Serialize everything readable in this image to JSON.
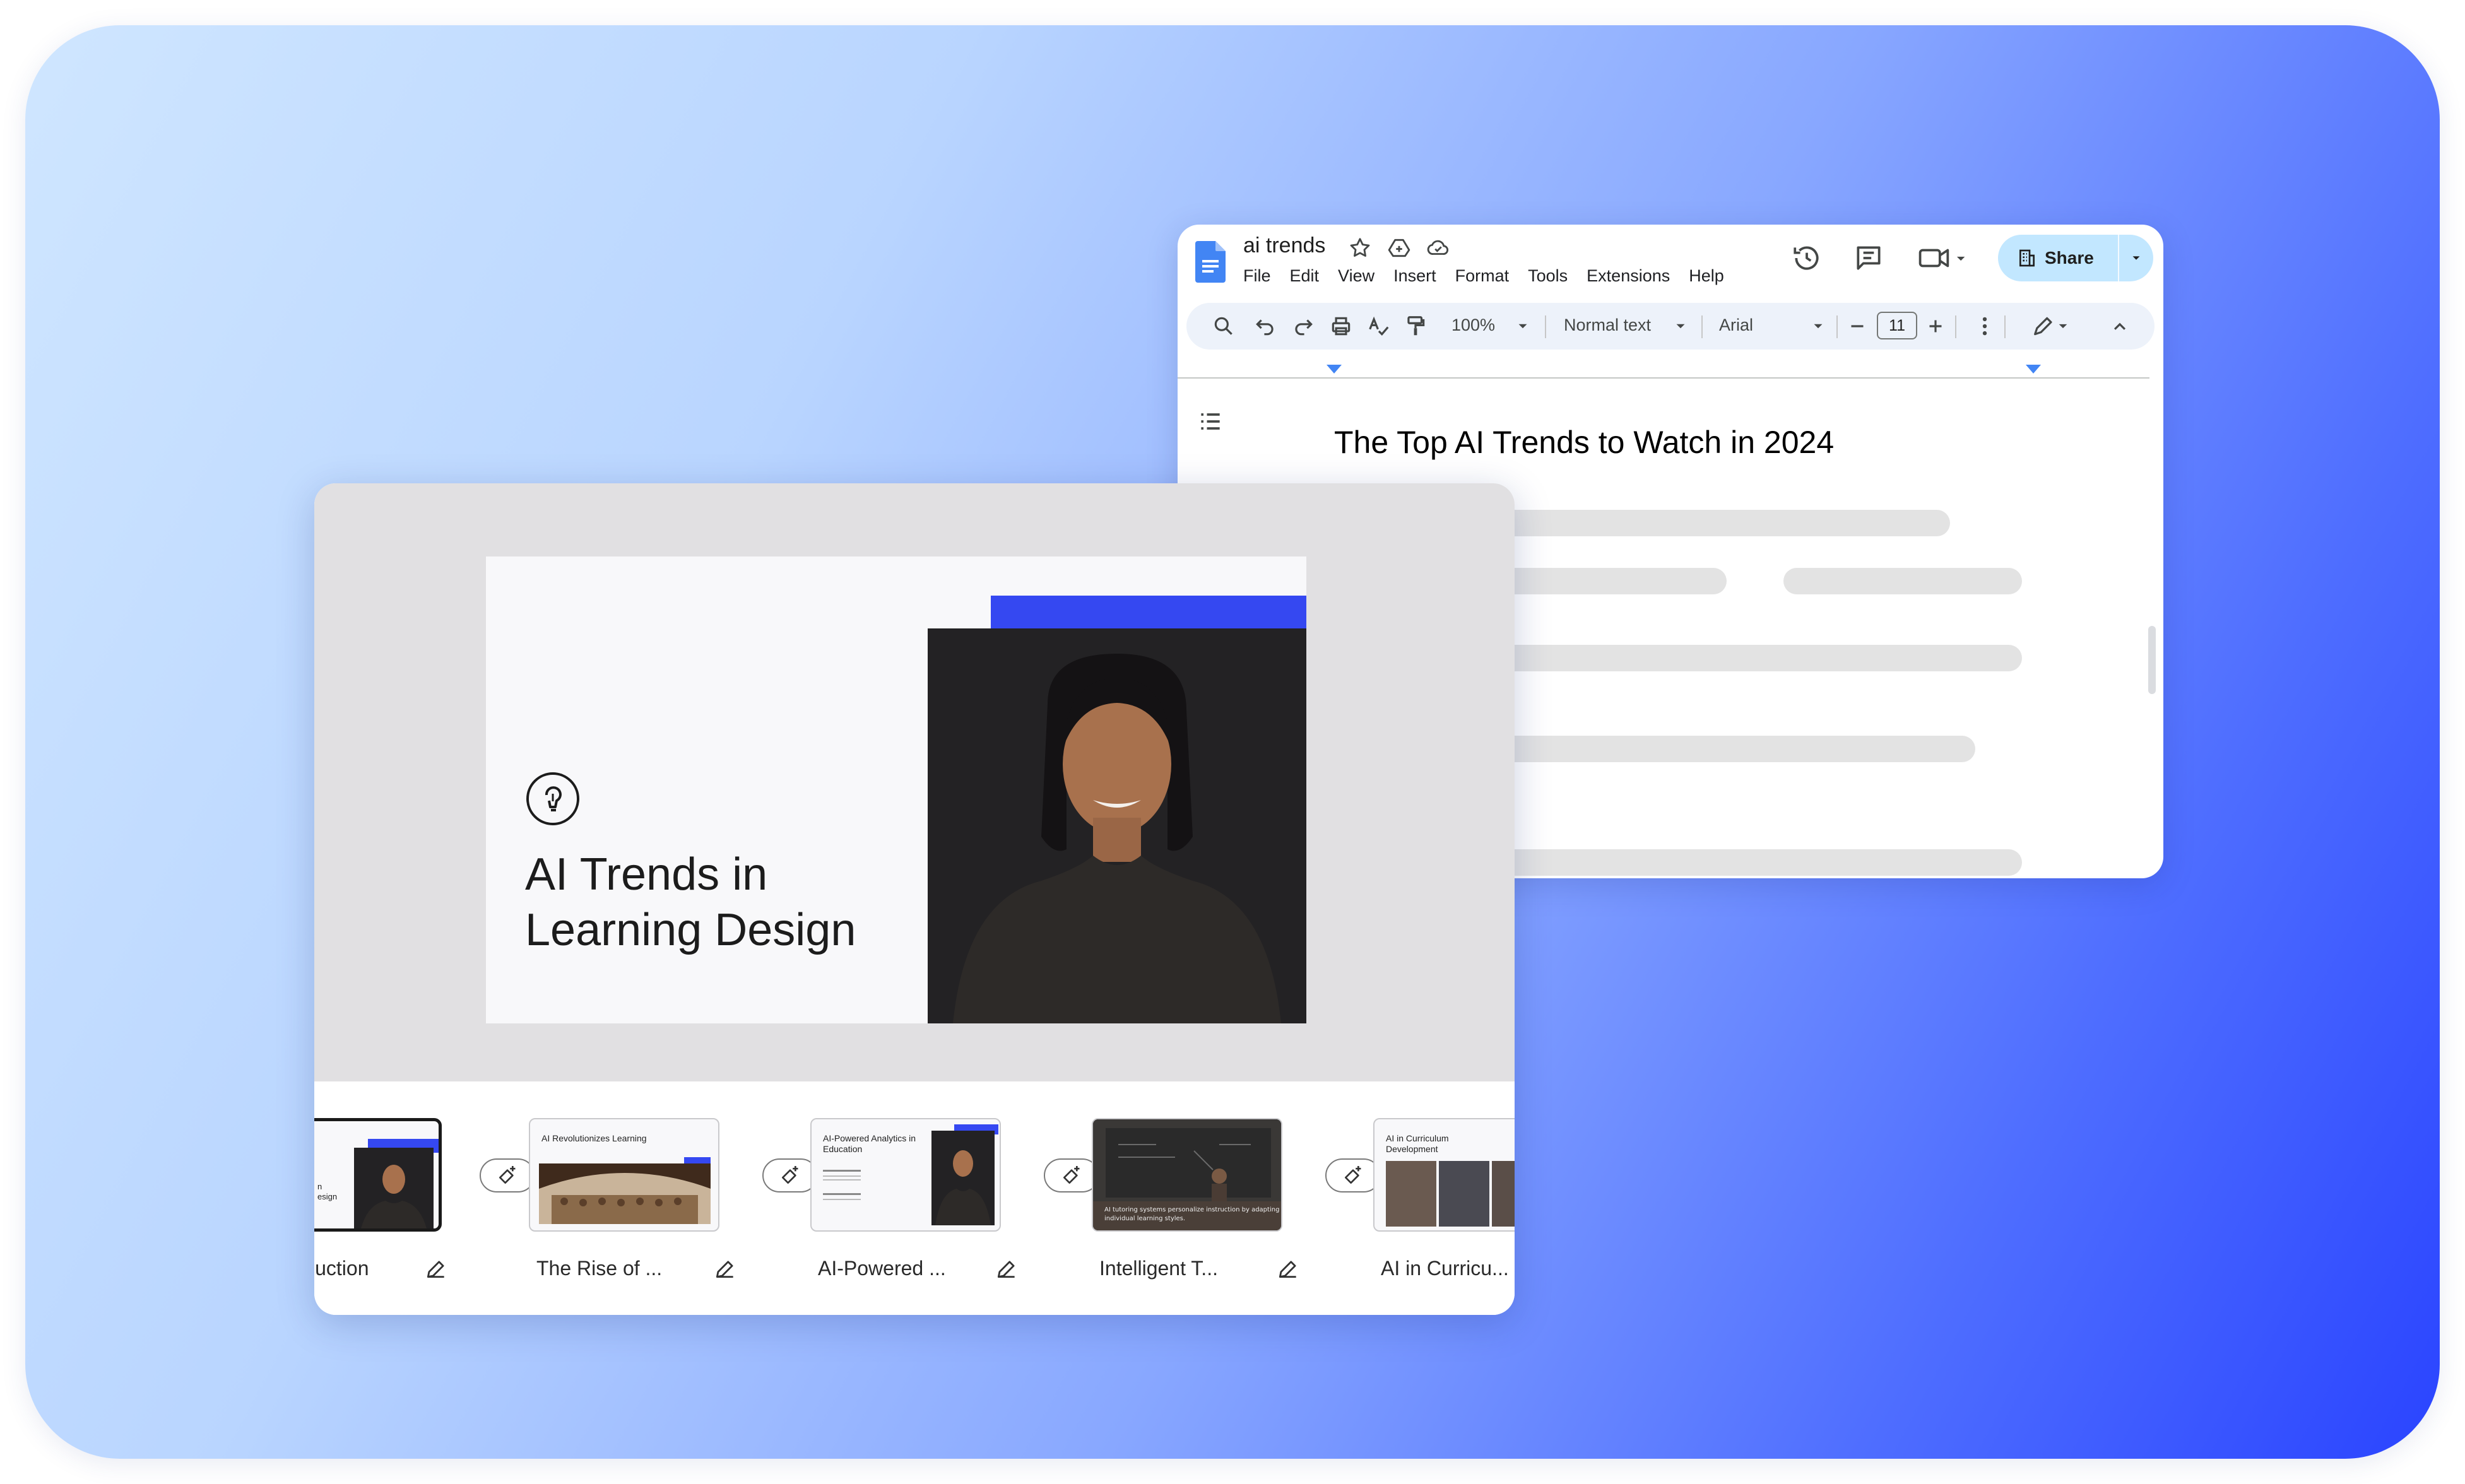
{
  "docs": {
    "title": "ai trends",
    "menu": [
      "File",
      "Edit",
      "View",
      "Insert",
      "Format",
      "Tools",
      "Extensions",
      "Help"
    ],
    "share_label": "Share",
    "toolbar": {
      "zoom": "100%",
      "style": "Normal text",
      "font": "Arial",
      "font_size": "11"
    },
    "heading": "The Top AI Trends to Watch in 2024"
  },
  "slides": {
    "current_slide_title": "AI Trends in Learning Design",
    "thumbnails": [
      {
        "label": "luction",
        "title": ""
      },
      {
        "label": "The Rise of ...",
        "title": "AI Revolutionizes Learning"
      },
      {
        "label": "AI-Powered ...",
        "title": "AI-Powered Analytics in Education"
      },
      {
        "label": "Intelligent T...",
        "title": ""
      },
      {
        "label": "AI in Curricu...",
        "title": "AI in Curriculum Development"
      }
    ]
  },
  "colors": {
    "accent_blue": "#3548f1",
    "share_bg": "#c2e7ff",
    "docs_blue": "#4285f4"
  }
}
